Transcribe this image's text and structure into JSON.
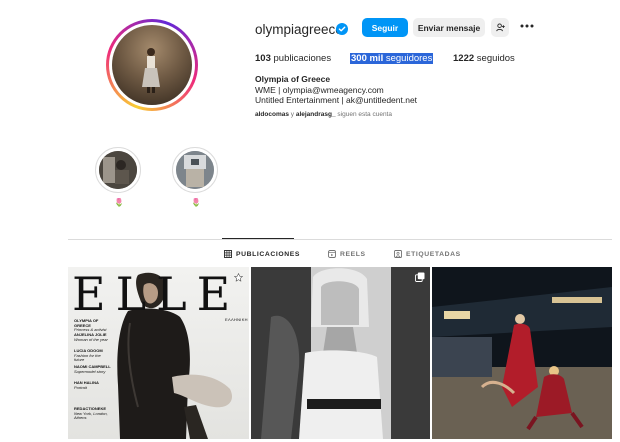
{
  "profile": {
    "username": "olympiagreece",
    "verified": true,
    "buttons": {
      "follow": "Seguir",
      "message": "Enviar mensaje"
    },
    "stats": {
      "posts_count": "103",
      "posts_label": "publicaciones",
      "followers_count": "300 mil",
      "followers_label": "seguidores",
      "following_count": "1222",
      "following_label": "seguidos"
    },
    "bio": {
      "name": "Olympia of Greece",
      "line1": "WME | olympia@wmeagency.com",
      "line2": "Untitled Entertainment | ak@untitledent.net"
    },
    "mutual": {
      "user1": "aldocomas",
      "connector": "y",
      "user2": "alejandrasg_",
      "suffix": "siguen esta cuenta"
    }
  },
  "highlights": [
    {
      "label": "🌷"
    },
    {
      "label": "🌷"
    }
  ],
  "tabs": [
    {
      "label": "PUBLICACIONES",
      "icon": "grid-icon",
      "active": true
    },
    {
      "label": "REELS",
      "icon": "reels-icon",
      "active": false
    },
    {
      "label": "ETIQUETADAS",
      "icon": "tagged-icon",
      "active": false
    }
  ],
  "posts": {
    "cover": {
      "masthead": "ELLE",
      "masthead_sub": "ΕΛΛΗΝΙΚΗ",
      "lines": [
        {
          "title": "OLYMPIA OF GREECE",
          "sub": "Princess & activist"
        },
        {
          "title": "ANJELINA JOLIE",
          "sub": "Woman of the year"
        },
        {
          "title": "LUCIA ODOOM",
          "sub": "Fashion for the future"
        },
        {
          "title": "NAOMI CAMPBELL",
          "sub": "Supermodel story"
        },
        {
          "title": "HAN HALINA",
          "sub": "Portrait"
        },
        {
          "title": "REDACTIONEKE",
          "sub": "New York, London, Athens"
        }
      ]
    }
  },
  "colors": {
    "accent": "#0095f6",
    "selection": "#2b66d9",
    "text": "#262626",
    "muted": "#737373"
  }
}
